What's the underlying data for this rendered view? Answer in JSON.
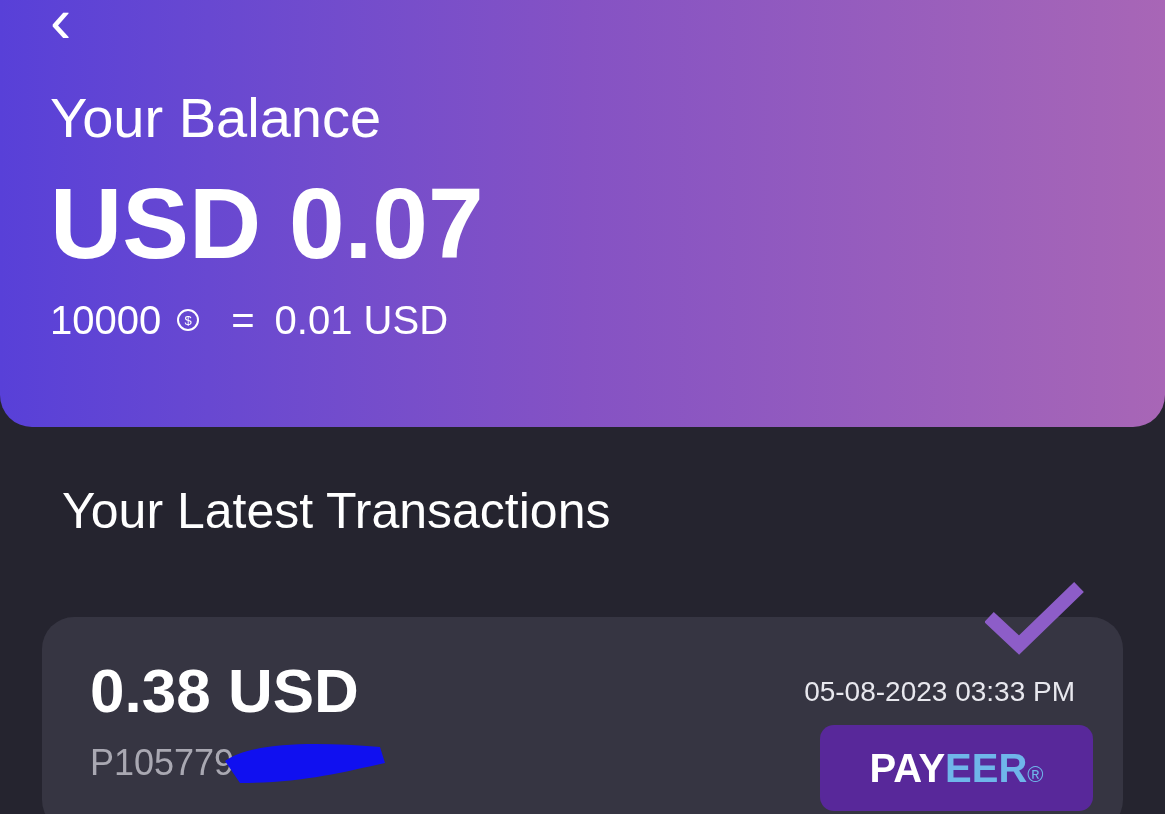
{
  "header": {
    "back": "‹",
    "title": "Your Balance",
    "balance": "USD 0.07",
    "rate": {
      "coins": "10000",
      "coin_symbol": "$",
      "equals": "=",
      "value": "0.01 USD"
    }
  },
  "transactions": {
    "title": "Your Latest Transactions",
    "items": [
      {
        "amount": "0.38 USD",
        "account": "P105779",
        "redacted": true,
        "date": "05-08-2023 03:33 PM",
        "verified": true,
        "method": {
          "main": "PAY",
          "accent": "EER",
          "mark": "®"
        }
      }
    ]
  }
}
